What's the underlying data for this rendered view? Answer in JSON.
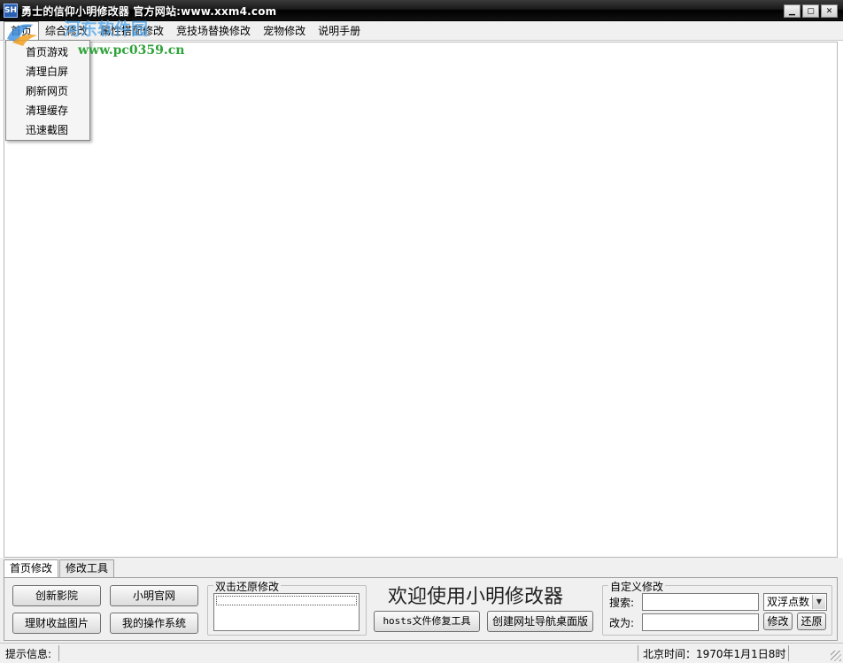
{
  "window": {
    "title": "勇士的信仰小明修改器 官方网站:www.xxm4.com",
    "icon_text": "SH"
  },
  "watermark": {
    "site_name": "河东软件园",
    "url": "www.pc0359.cn"
  },
  "menu": {
    "items": [
      {
        "label": "首页"
      },
      {
        "label": "综合修改"
      },
      {
        "label": "属性搭配修改"
      },
      {
        "label": "竞技场替换修改"
      },
      {
        "label": "宠物修改"
      },
      {
        "label": "说明手册"
      }
    ]
  },
  "dropdown": {
    "items": [
      {
        "label": "首页游戏"
      },
      {
        "label": "清理白屏"
      },
      {
        "label": "刷新网页"
      },
      {
        "label": "清理缓存"
      },
      {
        "label": "迅速截图"
      }
    ]
  },
  "tabs": [
    {
      "label": "首页修改"
    },
    {
      "label": "修改工具"
    }
  ],
  "panel": {
    "buttons": {
      "chuangxin": "创新影院",
      "xiaoming_site": "小明官网",
      "licai": "理财收益图片",
      "my_os": "我的操作系统",
      "hosts_fix": "hosts文件修复工具",
      "create_nav": "创建网址导航桌面版",
      "modify": "修改",
      "restore": "还原"
    },
    "restore_group_label": "双击还原修改",
    "welcome": "欢迎使用小明修改器",
    "custom_group_label": "自定义修改",
    "search_label": "搜索:",
    "replace_label": "改为:",
    "search_value": "",
    "replace_value": "",
    "number_type": "双浮点数"
  },
  "status": {
    "label": "提示信息:",
    "time": "北京时间：1970年1月1日8时"
  }
}
